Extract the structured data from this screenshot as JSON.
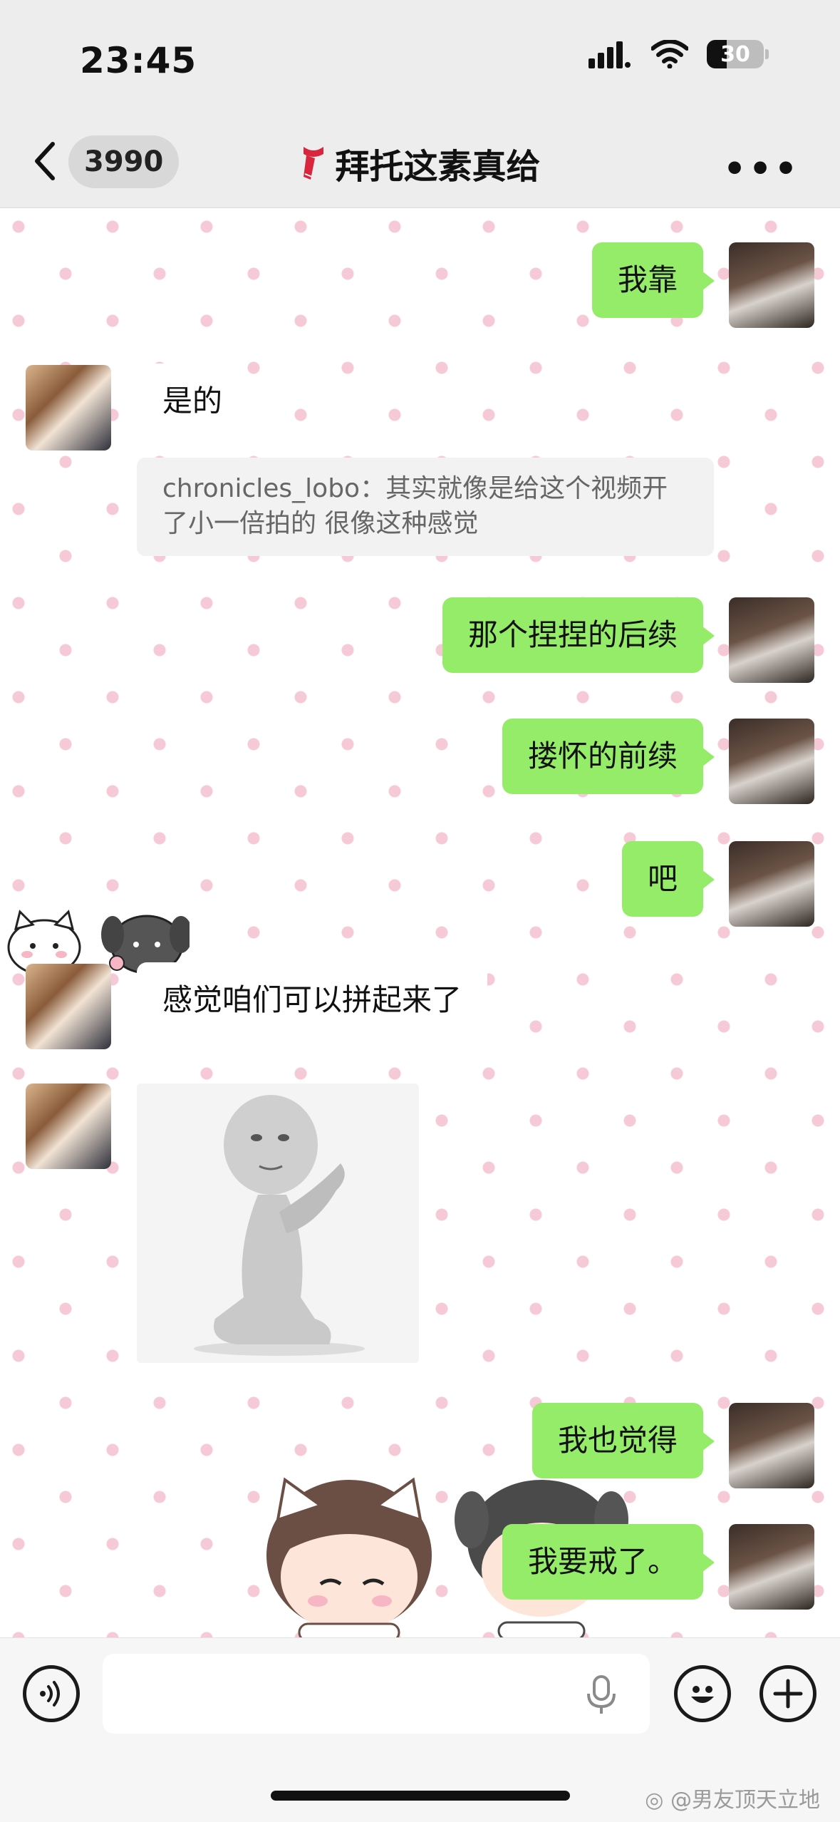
{
  "status_bar": {
    "time": "23:45",
    "battery": "30"
  },
  "nav": {
    "unread_count": "3990",
    "title": "拜托这素真给",
    "title_icon": "scarf-emoji"
  },
  "messages": [
    {
      "side": "me",
      "type": "text",
      "text": "我靠"
    },
    {
      "side": "them",
      "type": "text",
      "text": "是的"
    },
    {
      "side": "them",
      "type": "quote",
      "text": "chronicles_lobo：其实就像是给这个视频开了小一倍拍的 很像这种感觉"
    },
    {
      "side": "me",
      "type": "text",
      "text": "那个捏捏的后续"
    },
    {
      "side": "me",
      "type": "text",
      "text": "搂怀的前续"
    },
    {
      "side": "me",
      "type": "text",
      "text": "吧"
    },
    {
      "side": "them",
      "type": "text",
      "text": "感觉咱们可以拼起来了"
    },
    {
      "side": "them",
      "type": "sticker",
      "text": ""
    },
    {
      "side": "me",
      "type": "text",
      "text": "我也觉得"
    },
    {
      "side": "me",
      "type": "text",
      "text": "我要戒了。"
    }
  ],
  "input_bar": {
    "voice_icon": "voice-icon",
    "mic_icon": "mic-icon",
    "emoji_icon": "emoji-icon",
    "plus_icon": "plus-icon"
  },
  "watermark": "@男友顶天立地",
  "colors": {
    "me_bubble": "#95ec69",
    "them_bubble": "#ffffff",
    "dot": "#f6c9d7"
  }
}
